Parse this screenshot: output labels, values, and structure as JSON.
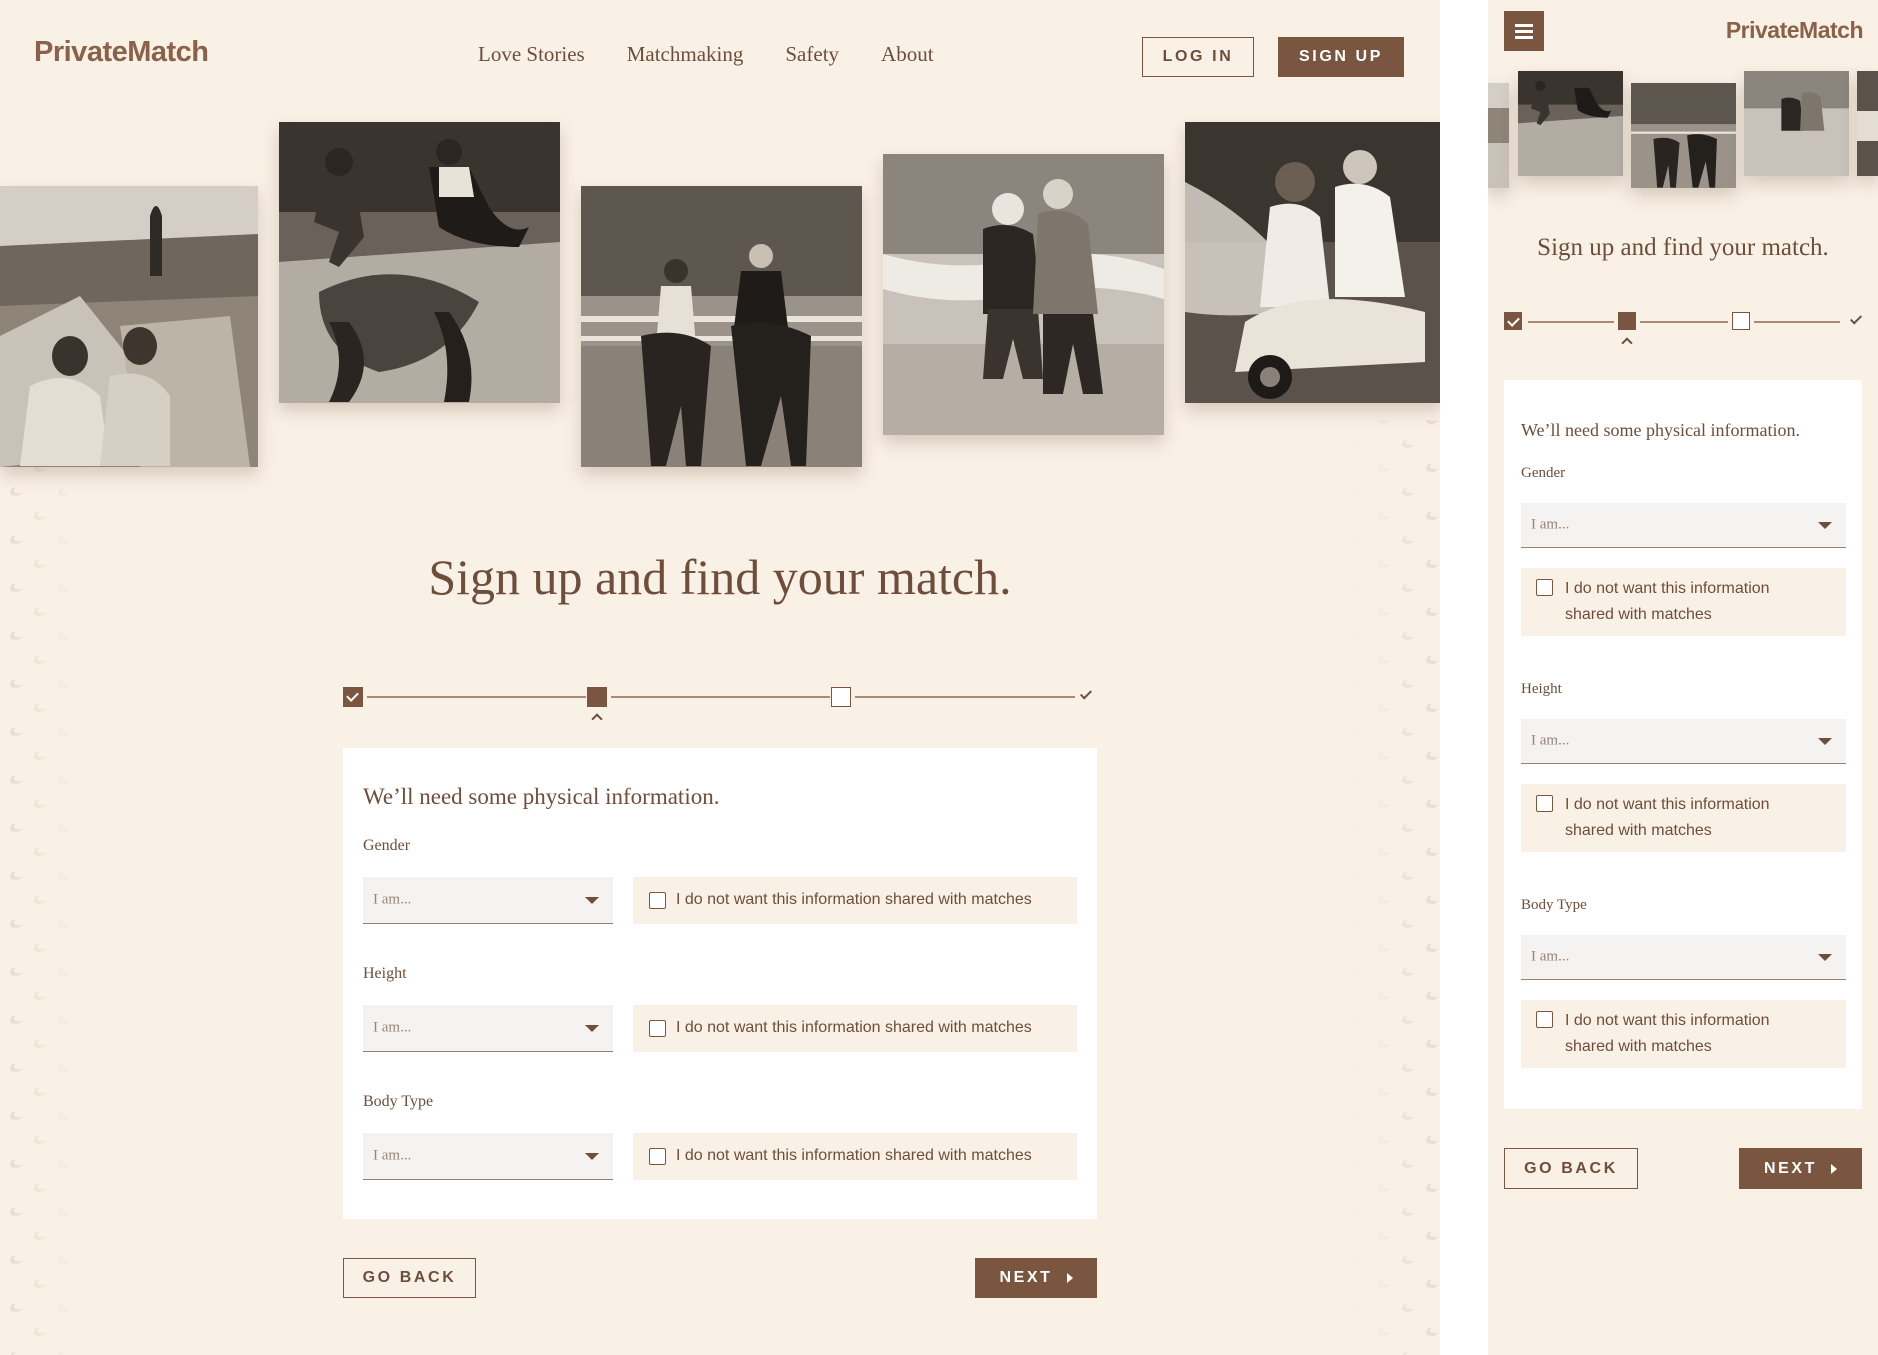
{
  "brand": {
    "logo": "PrivateMatch",
    "accent": "#7a5640",
    "background": "#f9f1e6"
  },
  "nav": {
    "items": [
      "Love Stories",
      "Matchmaking",
      "Safety",
      "About"
    ]
  },
  "header": {
    "login_label": "LOG IN",
    "signup_label": "SIGN UP"
  },
  "page": {
    "title": "Sign up and find your match."
  },
  "stepper": {
    "total_steps": 3,
    "current_step": 2
  },
  "form": {
    "section_title": "We’ll need some physical information.",
    "fields": [
      {
        "label": "Gender",
        "placeholder": "I am...",
        "optout": "I do not want this information shared with matches"
      },
      {
        "label": "Height",
        "placeholder": "I am...",
        "optout": "I do not want this information shared with matches"
      },
      {
        "label": "Body Type",
        "placeholder": "I am...",
        "optout": "I do not want this information shared with matches"
      }
    ]
  },
  "actions": {
    "back_label": "GO BACK",
    "next_label": "NEXT"
  },
  "mobile": {
    "optout_line1": "I do not want this information",
    "optout_line2": "shared with matches"
  },
  "icons": {
    "menu": "hamburger-icon",
    "dropdown": "chevron-down-icon",
    "next": "arrow-right-icon"
  }
}
